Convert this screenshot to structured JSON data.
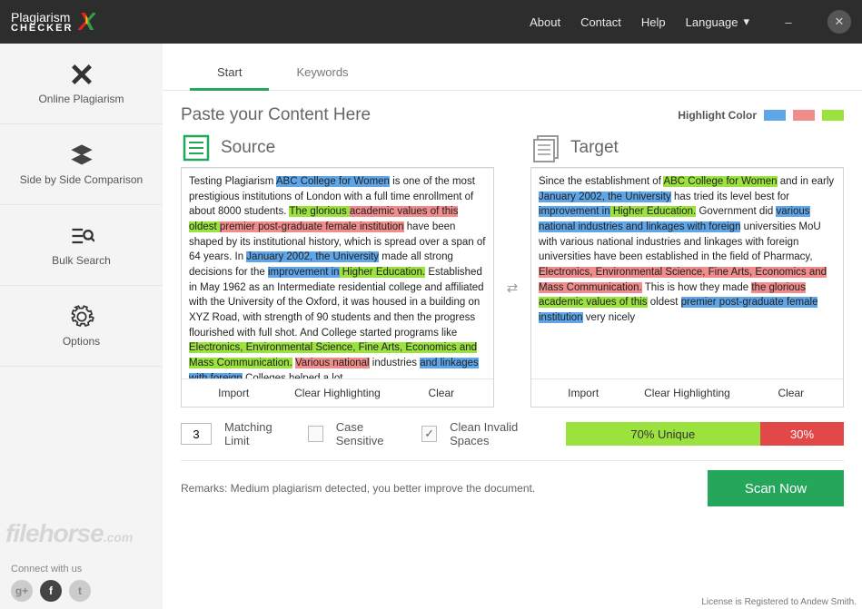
{
  "app": {
    "name_top": "Plagiarism",
    "name_bottom": "CHECKER"
  },
  "topnav": {
    "about": "About",
    "contact": "Contact",
    "help": "Help",
    "language": "Language"
  },
  "sidebar": {
    "items": [
      {
        "label": "Online Plagiarism"
      },
      {
        "label": "Side by Side Comparison"
      },
      {
        "label": "Bulk Search"
      },
      {
        "label": "Options"
      }
    ],
    "connect": "Connect with us"
  },
  "tabs": {
    "start": "Start",
    "keywords": "Keywords"
  },
  "heading": "Paste your Content Here",
  "highlight_label": "Highlight Color",
  "swatches": [
    "#5fa6e8",
    "#f08c8c",
    "#9be23e"
  ],
  "source": {
    "title": "Source"
  },
  "target": {
    "title": "Target"
  },
  "actions": {
    "import": "Import",
    "clear_hl": "Clear Highlighting",
    "clear": "Clear"
  },
  "controls": {
    "matching_limit_value": "3",
    "matching_limit": "Matching Limit",
    "case_sensitive": "Case Sensitive",
    "clean_spaces": "Clean Invalid Spaces"
  },
  "result": {
    "unique_pct": "70% Unique",
    "plag_pct": "30%"
  },
  "remarks": "Remarks: Medium plagiarism detected, you better improve the document.",
  "scan": "Scan Now",
  "license": "License is Registered to Andew Smith.",
  "source_text": {
    "p1a": "Testing Plagiarism ",
    "p1b": "ABC College for Women",
    "p1c": " is one of the most prestigious institutions of London with a full time enrollment of about 8000 students. ",
    "p2a": "The glorious ",
    "p2b": "academic values of this",
    "p2c": " oldest ",
    "p2d": "premier post-graduate female institution",
    "p2e": " have been shaped by its institutional history, which is spread over a span of 64 years. In ",
    "p2f": "January 2002, the University",
    "p2g": " made all strong decisions for the ",
    "p2h": "improvement in",
    "p2i": " Higher Education.",
    "p3": " Established in May 1962 as an Intermediate residential college and affiliated with the University of the Oxford, it was housed in a building on XYZ Road, with strength of 90 students and then the progress flourished with full shot. And College started programs like ",
    "p3b": "Electronics, Environmental Science, Fine Arts, Economics and Mass Communication.",
    "p3c": " ",
    "p3d": "Various national",
    "p3e": " industries ",
    "p3f": "and linkages with foreign",
    "p3g": " Colleges helped a lot…"
  },
  "target_text": {
    "t1a": "Since the establishment of ",
    "t1b": "ABC College for Women",
    "t1c": " and in early ",
    "t1d": "January 2002, the University",
    "t1e": " has tried its level best for ",
    "t1f": "improvement in",
    "t1g": " Higher Education.",
    "t2a": " Government did ",
    "t2b": "various national industries and linkages with foreign",
    "t2c": " universities MoU with various national industries and linkages with foreign universities have been established in the field of Pharmacy, ",
    "t2d": "Electronics, Environmental Science, Fine Arts, Economics and Mass Communication.",
    "t2e": " This is how they made ",
    "t2f": "the glorious",
    "t2g": " ",
    "t2h": "academic values of this",
    "t2i": " oldest ",
    "t2j": "premier post-graduate female institution",
    "t2k": " very nicely"
  }
}
